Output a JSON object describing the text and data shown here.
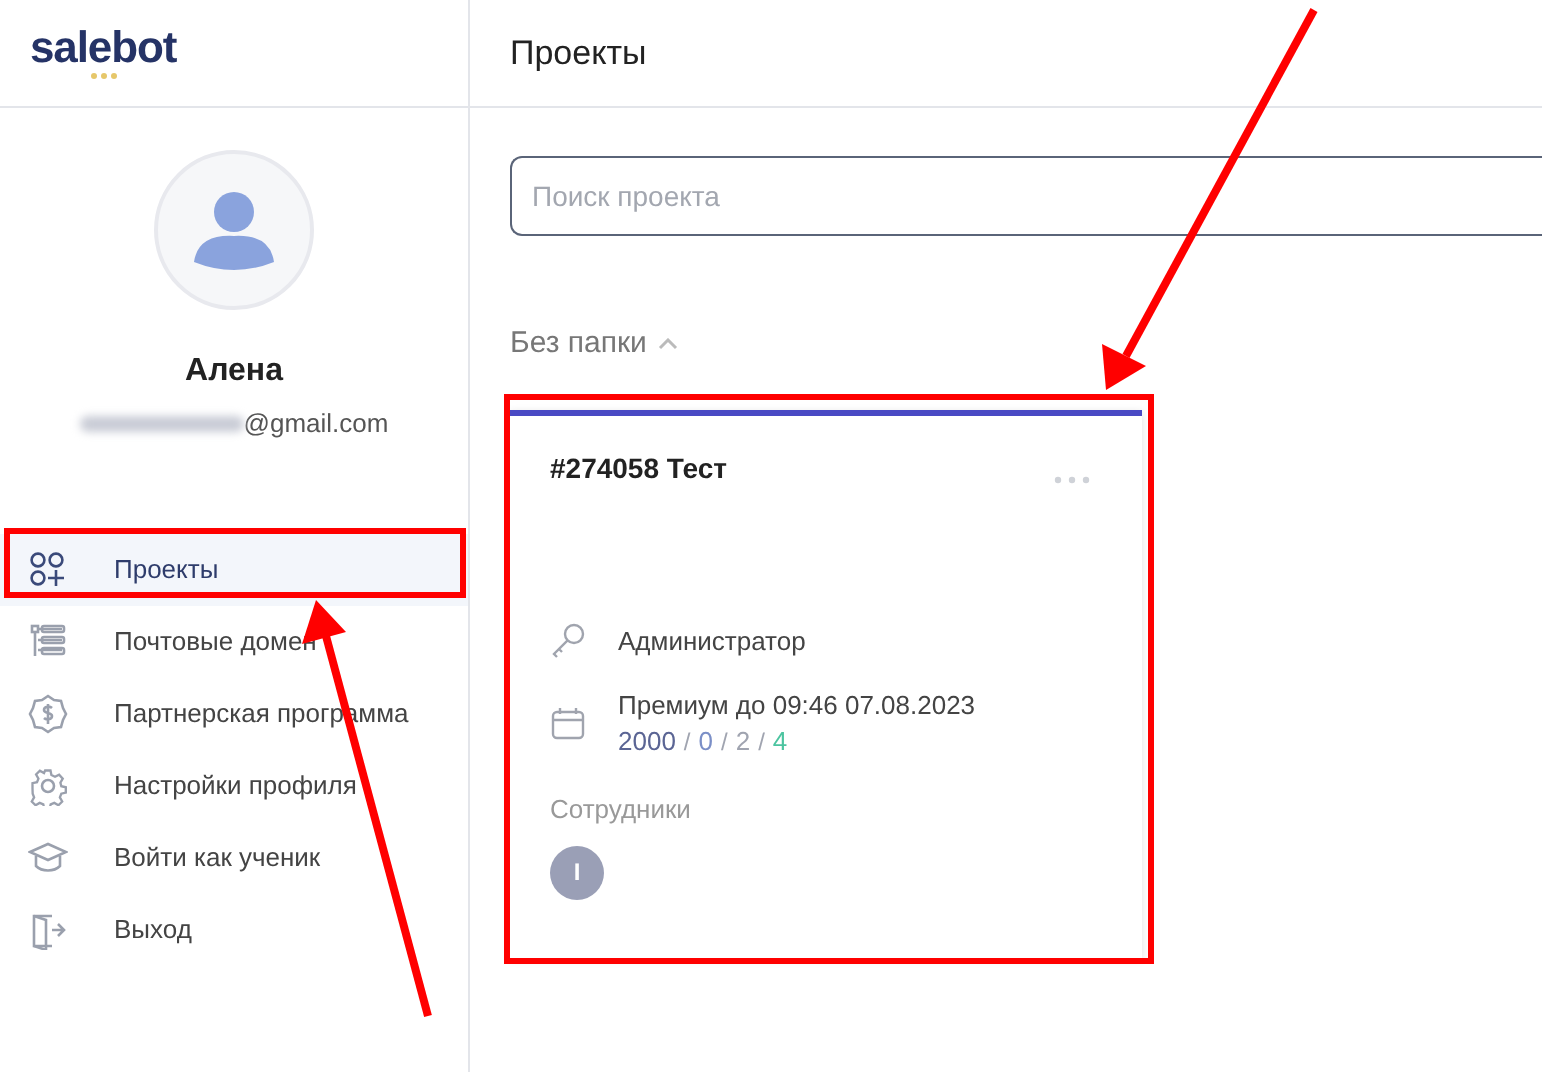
{
  "logo": {
    "text": "salebot"
  },
  "profile": {
    "name": "Алена",
    "email_visible": "@gmail.com"
  },
  "sidebar": {
    "items": [
      {
        "label": "Проекты",
        "kind": "grid",
        "selected": true
      },
      {
        "label": "Почтовые домен",
        "kind": "list",
        "selected": false
      },
      {
        "label": "Партнерская программа",
        "kind": "dollar",
        "selected": false
      },
      {
        "label": "Настройки профиля",
        "kind": "gear",
        "selected": false
      },
      {
        "label": "Войти как ученик",
        "kind": "cap",
        "selected": false
      },
      {
        "label": "Выход",
        "kind": "exit",
        "selected": false
      }
    ]
  },
  "header": {
    "title": "Проекты"
  },
  "search": {
    "placeholder": "Поиск проекта"
  },
  "folder": {
    "label": "Без папки",
    "expanded": true
  },
  "projects": [
    {
      "title": "#274058 Тест",
      "role": "Администратор",
      "plan": "Премиум до 09:46 07.08.2023",
      "counts": [
        {
          "kind": "value",
          "text": "2000",
          "color": "#5b6594"
        },
        {
          "kind": "separator",
          "text": "/",
          "color": "#a0a4b0"
        },
        {
          "kind": "value",
          "text": "0",
          "color": "#7b8fc7"
        },
        {
          "kind": "separator",
          "text": "/",
          "color": "#a0a4b0"
        },
        {
          "kind": "value",
          "text": "2",
          "color": "#a0a4b0"
        },
        {
          "kind": "separator",
          "text": "/",
          "color": "#a0a4b0"
        },
        {
          "kind": "value",
          "text": "4",
          "color": "#4cc4a0"
        }
      ],
      "employees_label": "Сотрудники",
      "employees": [
        {
          "initial": "I"
        }
      ]
    }
  ]
}
